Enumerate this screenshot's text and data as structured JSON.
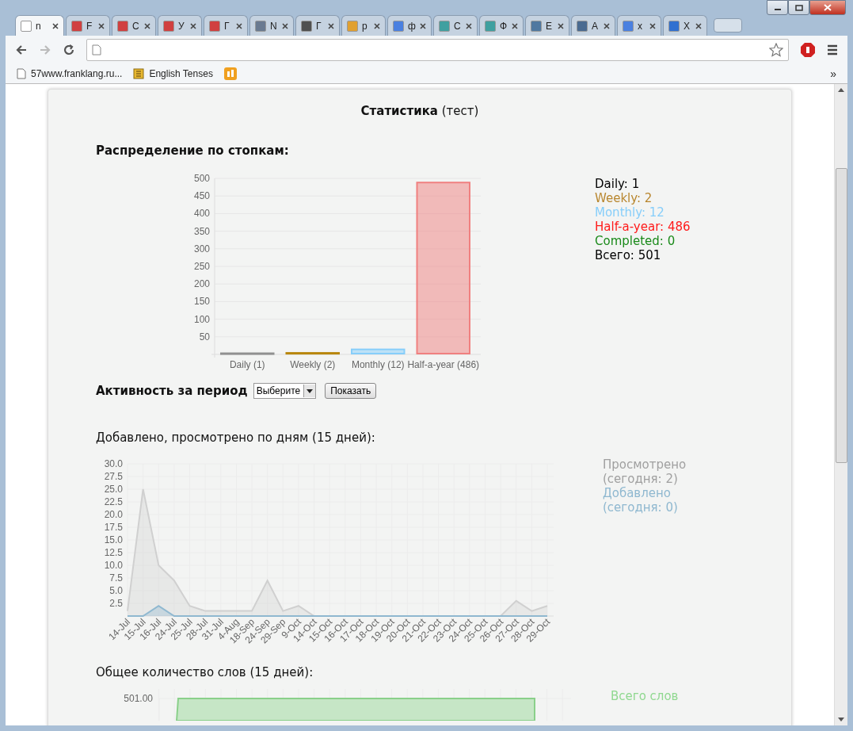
{
  "browser": {
    "tabs": [
      {
        "title": "n",
        "selected": true,
        "color": "#ffffff"
      },
      {
        "title": "F",
        "selected": false,
        "color": "#d04040"
      },
      {
        "title": "C",
        "selected": false,
        "color": "#d04040"
      },
      {
        "title": "У",
        "selected": false,
        "color": "#d04040"
      },
      {
        "title": "Г",
        "selected": false,
        "color": "#d04040"
      },
      {
        "title": "N",
        "selected": false,
        "color": "#6a7a90"
      },
      {
        "title": "Г",
        "selected": false,
        "color": "#505050"
      },
      {
        "title": "p",
        "selected": false,
        "color": "#e0a030"
      },
      {
        "title": "ф",
        "selected": false,
        "color": "#4a80e0"
      },
      {
        "title": "C",
        "selected": false,
        "color": "#40a0a0"
      },
      {
        "title": "Ф",
        "selected": false,
        "color": "#40a0a0"
      },
      {
        "title": "E",
        "selected": false,
        "color": "#5078a0"
      },
      {
        "title": "A",
        "selected": false,
        "color": "#4a6a90"
      },
      {
        "title": "x",
        "selected": false,
        "color": "#4a80e0"
      },
      {
        "title": "X",
        "selected": false,
        "color": "#3070d0"
      }
    ],
    "bookmarks": [
      {
        "title": "57www.franklang.ru...",
        "kind": "page"
      },
      {
        "title": "English Tenses",
        "kind": "book"
      },
      {
        "kind": "app"
      }
    ],
    "bookmarks_overflow": "»"
  },
  "page": {
    "title": "Статистика",
    "title_note": "(тест)",
    "distribution": {
      "heading": "Распределение по стопкам:",
      "chart_data": {
        "type": "bar",
        "grid": true,
        "categories": [
          "Daily (1)",
          "Weekly (2)",
          "Monthly (12)",
          "Half-a-year (486)"
        ],
        "values": [
          1,
          2,
          12,
          486
        ],
        "colors": [
          "#909090",
          "#b8860b",
          "#87cefa",
          "#f08080"
        ],
        "ylim": [
          0,
          500
        ],
        "yticks": [
          50,
          100,
          150,
          200,
          250,
          300,
          350,
          400,
          450,
          500
        ]
      },
      "legend": [
        {
          "label": "Daily: 1",
          "color": "#000000"
        },
        {
          "label": "Weekly: 2",
          "color": "#b8862e"
        },
        {
          "label": "Monthly: 12",
          "color": "#87cefa"
        },
        {
          "label": "Half-a-year: 486",
          "color": "#ff1a1a"
        },
        {
          "label": "Completed: 0",
          "color": "#1a8a1a"
        },
        {
          "label": "Всего: 501",
          "color": "#000000"
        }
      ]
    },
    "activity": {
      "heading": "Активность за период",
      "select": {
        "value": "Выберите"
      },
      "button": "Показать"
    },
    "daily": {
      "heading": "Добавлено, просмотрено по дням (15 дней):",
      "chart_data": {
        "type": "area",
        "grid": true,
        "categories": [
          "14-Jul",
          "15-Jul",
          "16-Jul",
          "24-Jul",
          "25-Jul",
          "28-Jul",
          "31-Jul",
          "4-Aug",
          "18-Sep",
          "24-Sep",
          "29-Sep",
          "9-Oct",
          "14-Oct",
          "15-Oct",
          "16-Oct",
          "17-Oct",
          "18-Oct",
          "19-Oct",
          "20-Oct",
          "21-Oct",
          "22-Oct",
          "23-Oct",
          "24-Oct",
          "25-Oct",
          "26-Oct",
          "27-Oct",
          "28-Oct",
          "29-Oct"
        ],
        "ylim": [
          0,
          30
        ],
        "yticks": [
          {
            "value": 2.5,
            "label": "2.5"
          },
          {
            "value": 5,
            "label": "5.0"
          },
          {
            "value": 7.5,
            "label": "7.5"
          },
          {
            "value": 10,
            "label": "10.0"
          },
          {
            "value": 12.5,
            "label": "12.5"
          },
          {
            "value": 15,
            "label": "15.0"
          },
          {
            "value": 17.5,
            "label": "17.5"
          },
          {
            "value": 20,
            "label": "20.0"
          },
          {
            "value": 22.5,
            "label": "22.5"
          },
          {
            "value": 25,
            "label": "25.0"
          },
          {
            "value": 27.5,
            "label": "27.5"
          },
          {
            "value": 30,
            "label": "30.0"
          }
        ],
        "series": [
          {
            "name": "Просмотрено",
            "color": "#d0d0d0",
            "values": [
              1,
              25,
              10,
              7,
              2,
              1,
              1,
              1,
              1,
              7,
              1,
              2,
              0,
              0,
              0,
              0,
              0,
              0,
              0,
              0,
              0,
              0,
              0,
              0,
              0,
              3,
              1,
              2
            ]
          },
          {
            "name": "Добавлено",
            "color": "#8fb8d0",
            "values": [
              0,
              0,
              2,
              0,
              0,
              0,
              0,
              0,
              0,
              0,
              0,
              0,
              0,
              0,
              0,
              0,
              0,
              0,
              0,
              0,
              0,
              0,
              0,
              0,
              0,
              0,
              0,
              0
            ]
          }
        ]
      },
      "legend": [
        {
          "today": "(сегодня: 2)",
          "color": "#a0a0a0"
        },
        {
          "today": "(сегодня: 0)",
          "color": "#8fb8d0"
        }
      ]
    },
    "total": {
      "heading": "Общее количество слов (15 дней):",
      "ytick": "501.00",
      "legend": [
        {
          "label": "Всего слов",
          "color": "#90d890"
        }
      ]
    }
  }
}
